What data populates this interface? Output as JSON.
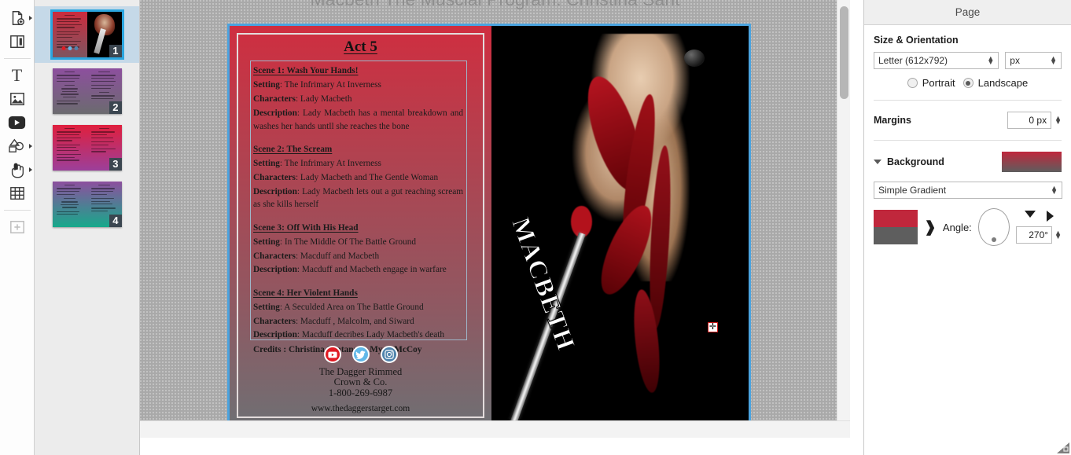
{
  "document": {
    "title": "Macbeth The Muscial Program: Christina Sant"
  },
  "toolbar": {
    "items": [
      {
        "name": "add-page",
        "icon": "page-plus-icon",
        "has_submenu": true
      },
      {
        "name": "page-layout",
        "icon": "page-layout-icon",
        "has_submenu": false
      },
      {
        "name": "text-tool",
        "icon": "text-icon",
        "label": "T",
        "has_submenu": false
      },
      {
        "name": "image-tool",
        "icon": "image-icon",
        "has_submenu": false
      },
      {
        "name": "video-tool",
        "icon": "video-icon",
        "has_submenu": false
      },
      {
        "name": "shapes-tool",
        "icon": "shapes-icon",
        "has_submenu": true
      },
      {
        "name": "hand-tool",
        "icon": "hand-pointer-icon",
        "has_submenu": true
      },
      {
        "name": "table-tool",
        "icon": "table-icon",
        "has_submenu": false
      },
      {
        "name": "add-placeholder",
        "icon": "add-box-icon",
        "has_submenu": false
      }
    ]
  },
  "pages": {
    "thumbnails": [
      {
        "number": "1",
        "selected": true
      },
      {
        "number": "2",
        "selected": false
      },
      {
        "number": "3",
        "selected": false
      },
      {
        "number": "4",
        "selected": false
      }
    ]
  },
  "spread": {
    "act_title": "Act 5",
    "scenes": [
      {
        "heading": "Scene 1: Wash Your Hands!",
        "setting_label": "Setting",
        "setting": "The Infrimary At Inverness",
        "characters_label": "Characters",
        "characters": "Lady Macbeth",
        "description_label": "Description",
        "description": "Lady Macbeth  has a mental breakdown and washes her hands untll she reaches the bone"
      },
      {
        "heading": "Scene 2:  The Scream",
        "setting_label": "Setting",
        "setting": "The Infrimary At Inverness",
        "characters_label": "Characters",
        "characters": "Lady Macbeth and  The Gentle Woman",
        "description_label": "Description",
        "description": "Lady Macbeth lets out a gut reaching scream as she kills herself"
      },
      {
        "heading": "Scene 3:  Off With His Head",
        "setting_label": "Setting",
        "setting": "In The Middle Of The Battle Ground",
        "characters_label": "Characters",
        "characters": "Macduff and  Macbeth",
        "description_label": "Description",
        "description": "Macduff and Macbeth engage in warfare"
      },
      {
        "heading": "Scene 4:  Her Violent Hands",
        "setting_label": "Setting",
        "setting": "A Seculded Area on The Battle Ground",
        "characters_label": "Characters",
        "characters": "Macduff , Malcolm,  and Siward",
        "description_label": "Description",
        "description": "Macduff decribes Lady Macbeth's death"
      }
    ],
    "credits": "Credits : Christina Santana & Myah McCoy",
    "socials": [
      {
        "name": "youtube",
        "color": "#e01b24"
      },
      {
        "name": "twitter",
        "color": "#62b8e8"
      },
      {
        "name": "instagram",
        "color": "#4f83ac"
      }
    ],
    "contact": {
      "line1": "The Dagger Rimmed",
      "line2": "Crown & Co.",
      "line3": "1-800-269-6987",
      "url": "www.thedaggerstarget.com"
    },
    "artwork_title": "MACBETH"
  },
  "panel": {
    "header": "Page",
    "size_section": {
      "label": "Size & Orientation",
      "page_size": "Letter (612x792)",
      "unit": "px",
      "portrait_label": "Portrait",
      "landscape_label": "Landscape",
      "orientation_selected": "Landscape"
    },
    "margins": {
      "label": "Margins",
      "value": "0 px"
    },
    "background": {
      "label": "Background",
      "type": "Simple Gradient",
      "color_start": "#c0273c",
      "color_end": "#5e5e5e",
      "angle_label": "Angle:",
      "angle_value": "270°"
    }
  }
}
